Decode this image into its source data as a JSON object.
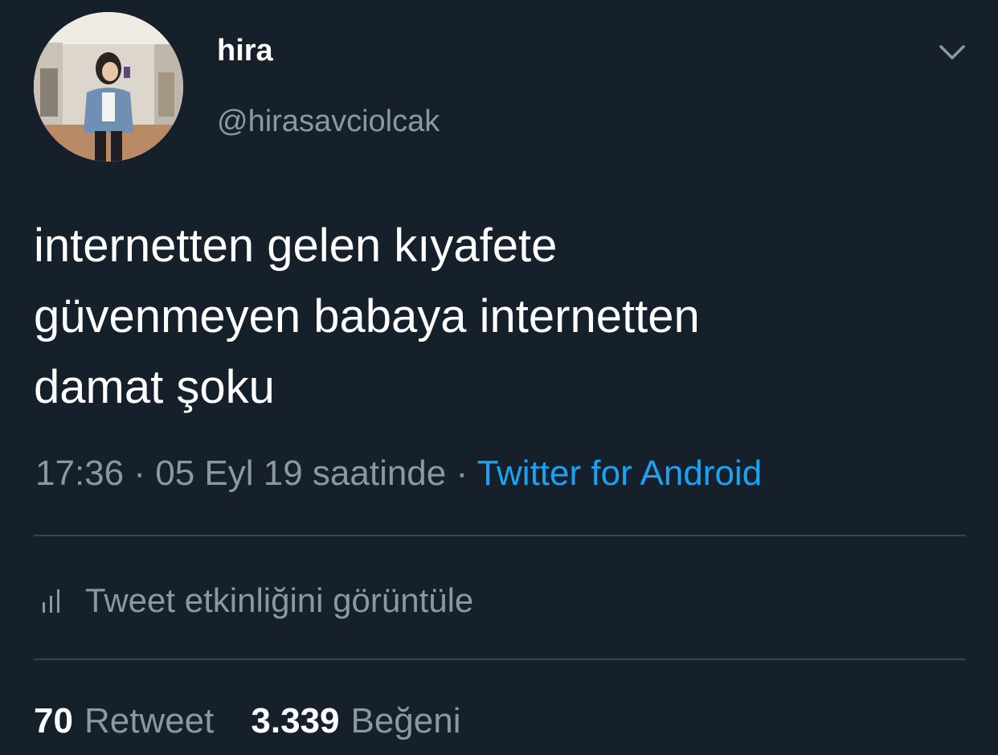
{
  "tweet": {
    "user": {
      "display_name": "hira",
      "handle": "@hirasavciolcak",
      "avatar_icon": "profile-photo"
    },
    "menu_icon": "chevron-down-icon",
    "text": "internetten gelen kıyafete\ngüvenmeyen babaya internetten\ndamat şoku",
    "meta": {
      "time": "17:36",
      "separator_1": " · ",
      "date": "05 Eyl 19 saatinde",
      "separator_2": " · ",
      "source": "Twitter for Android"
    },
    "analytics": {
      "icon": "bar-chart-icon",
      "label": "Tweet etkinliğini görüntüle"
    },
    "stats": {
      "retweets_count": "70",
      "retweets_label": "Retweet",
      "likes_count": "3.339",
      "likes_label": "Beğeni"
    }
  },
  "colors": {
    "background": "#15202b",
    "text_primary": "#ffffff",
    "text_secondary": "#8899a6",
    "link": "#1da1f2",
    "divider": "#38444d"
  }
}
